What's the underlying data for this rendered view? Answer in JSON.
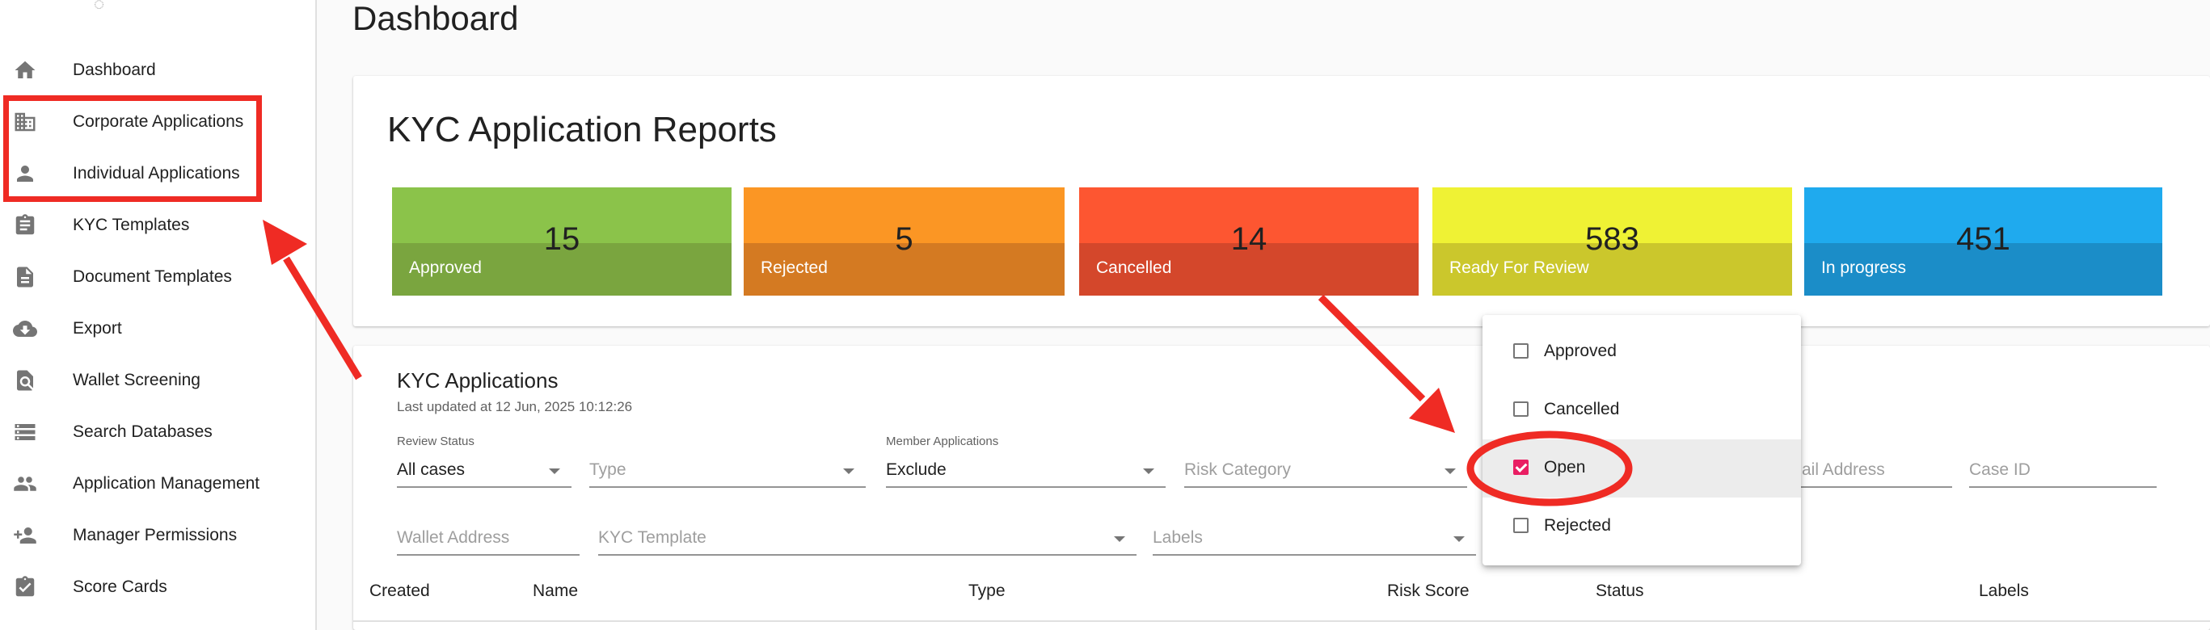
{
  "page": {
    "title": "Dashboard"
  },
  "sidebar": {
    "items": [
      {
        "label": "Dashboard",
        "icon": "home-icon"
      },
      {
        "label": "Corporate Applications",
        "icon": "building-icon"
      },
      {
        "label": "Individual Applications",
        "icon": "person-icon"
      },
      {
        "label": "KYC Templates",
        "icon": "clipboard-icon"
      },
      {
        "label": "Document Templates",
        "icon": "document-icon"
      },
      {
        "label": "Export",
        "icon": "cloud-download-icon"
      },
      {
        "label": "Wallet Screening",
        "icon": "find-in-page-icon"
      },
      {
        "label": "Search Databases",
        "icon": "storage-icon"
      },
      {
        "label": "Application Management",
        "icon": "people-icon"
      },
      {
        "label": "Manager Permissions",
        "icon": "person-add-icon"
      },
      {
        "label": "Score Cards",
        "icon": "assignment-check-icon"
      }
    ]
  },
  "reports": {
    "title": "KYC Application Reports",
    "stats": [
      {
        "value": "15",
        "label": "Approved",
        "color_top": "#8bc34a",
        "color_bottom": "#7aa53f"
      },
      {
        "value": "5",
        "label": "Rejected",
        "color_top": "#fb9624",
        "color_bottom": "#d47a22"
      },
      {
        "value": "14",
        "label": "Cancelled",
        "color_top": "#fd5631",
        "color_bottom": "#d4472b"
      },
      {
        "value": "583",
        "label": "Ready For Review",
        "color_top": "#eff234",
        "color_bottom": "#cbc72c"
      },
      {
        "value": "451",
        "label": "In progress",
        "color_top": "#1faaee",
        "color_bottom": "#1b8dc8"
      }
    ]
  },
  "applications": {
    "title": "KYC Applications",
    "updated": "Last updated at 12 Jun, 2025 10:12:26",
    "filters": {
      "review_status": {
        "label": "Review Status",
        "value": "All cases"
      },
      "type": {
        "placeholder": "Type"
      },
      "member_applications": {
        "label": "Member Applications",
        "value": "Exclude"
      },
      "risk_category": {
        "placeholder": "Risk Category"
      },
      "email": {
        "placeholder": "ail Address"
      },
      "case_id": {
        "placeholder": "Case ID"
      },
      "wallet_address": {
        "placeholder": "Wallet Address"
      },
      "kyc_template": {
        "placeholder": "KYC Template"
      },
      "labels": {
        "placeholder": "Labels"
      }
    },
    "columns": [
      "Created",
      "Name",
      "Type",
      "Risk Score",
      "Status",
      "Labels"
    ]
  },
  "status_menu": {
    "options": [
      {
        "label": "Approved",
        "checked": false
      },
      {
        "label": "Cancelled",
        "checked": false
      },
      {
        "label": "Open",
        "checked": true
      },
      {
        "label": "Rejected",
        "checked": false
      }
    ]
  },
  "colors": {
    "annotation_red": "#ef2b24",
    "checkbox_accent": "#e91e63"
  }
}
